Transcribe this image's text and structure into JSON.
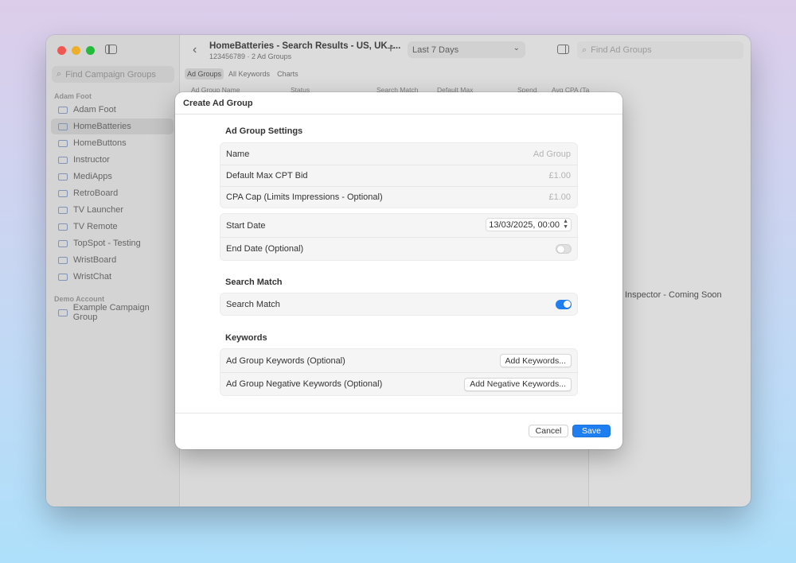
{
  "sidebar": {
    "search_placeholder": "Find Campaign Groups",
    "sections": [
      {
        "title": "Adam Foot"
      },
      {
        "title": "Demo Account"
      }
    ],
    "items": [
      {
        "label": "Adam Foot"
      },
      {
        "label": "HomeBatteries"
      },
      {
        "label": "HomeButtons"
      },
      {
        "label": "Instructor"
      },
      {
        "label": "MediApps"
      },
      {
        "label": "RetroBoard"
      },
      {
        "label": "TV Launcher"
      },
      {
        "label": "TV Remote"
      },
      {
        "label": "TopSpot - Testing"
      },
      {
        "label": "WristBoard"
      },
      {
        "label": "WristChat"
      },
      {
        "label": "Example Campaign Group"
      }
    ],
    "selected": "HomeBatteries"
  },
  "toolbar": {
    "title": "HomeBatteries - Search Results - US, UK -...",
    "subtitle": "123456789 · 2 Ad Groups",
    "period": "Last 7 Days",
    "find_placeholder": "Find Ad Groups"
  },
  "tabs": [
    "Ad Groups",
    "All Keywords",
    "Charts"
  ],
  "columns": [
    "Ad Group Name",
    "Status",
    "Search Match",
    "Default Max",
    "Spend",
    "Avg CPA (Ta"
  ],
  "inspector": {
    "placeholder": "Inspector - Coming Soon"
  },
  "dialog": {
    "title": "Create Ad Group",
    "settings_heading": "Ad Group Settings",
    "name_label": "Name",
    "name_placeholder": "Ad Group",
    "max_cpt_label": "Default Max CPT Bid",
    "max_cpt_placeholder": "£1.00",
    "cpa_label": "CPA Cap (Limits Impressions - Optional)",
    "cpa_placeholder": "£1.00",
    "start_label": "Start Date",
    "start_value": "13/03/2025, 00:00",
    "end_label": "End Date (Optional)",
    "end_enabled": false,
    "search_match_heading": "Search Match",
    "search_match_label": "Search Match",
    "search_match_enabled": true,
    "keywords_heading": "Keywords",
    "keywords_label": "Ad Group Keywords (Optional)",
    "add_keywords": "Add Keywords...",
    "neg_keywords_label": "Ad Group Negative Keywords (Optional)",
    "add_neg_keywords": "Add Negative Keywords...",
    "cancel": "Cancel",
    "save": "Save"
  },
  "colors": {
    "accent": "#1f7ff0",
    "close": "#ff5f57",
    "minimize": "#febc2e",
    "zoom": "#28c840"
  }
}
